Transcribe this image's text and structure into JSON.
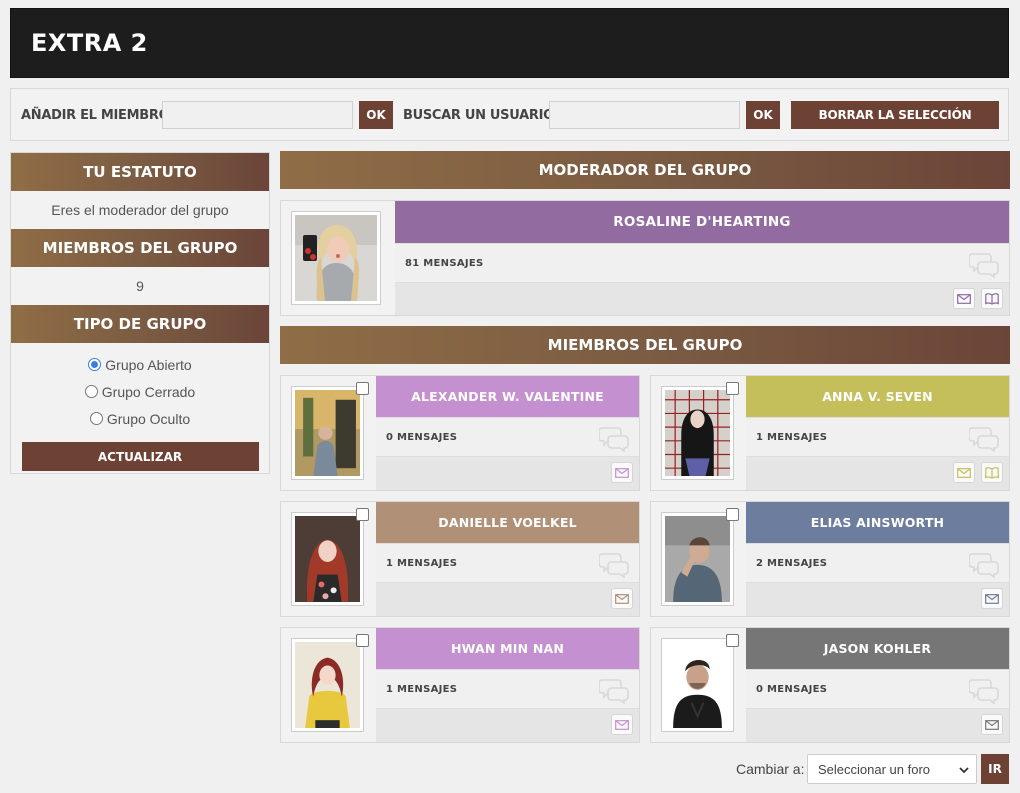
{
  "page": {
    "title": "EXTRA 2"
  },
  "toolbar": {
    "add_member_label": "AÑADIR EL MIEMBRO",
    "add_member_value": "",
    "ok_label": "OK",
    "search_user_label": "BUSCAR UN USUARIO",
    "search_user_value": "",
    "clear_selection_label": "BORRAR LA SELECCIÓN"
  },
  "sidebar": {
    "status_heading": "TU ESTATUTO",
    "status_text": "Eres el moderador del grupo",
    "members_heading": "MIEMBROS DEL GRUPO",
    "members_count": "9",
    "type_heading": "TIPO DE GRUPO",
    "types": [
      {
        "label": "Grupo Abierto",
        "checked": true
      },
      {
        "label": "Grupo Cerrado",
        "checked": false
      },
      {
        "label": "Grupo Oculto",
        "checked": false
      }
    ],
    "update_label": "ACTUALIZAR"
  },
  "moderator_section": {
    "heading": "MODERADOR DEL GRUPO",
    "moderator": {
      "name": "ROSALINE D'HEARTING",
      "messages": "81 MENSAJES",
      "color": "#926ba0",
      "icon_color": "#8e6aa6",
      "icons": [
        "mail-icon",
        "book-icon"
      ]
    }
  },
  "members_section": {
    "heading": "MIEMBROS DEL GRUPO",
    "members": [
      {
        "name": "ALEXANDER W. VALENTINE",
        "messages": "0 MENSAJES",
        "color": "#c490d0",
        "icon_color": "#c490d0",
        "icons": [
          "mail-icon"
        ]
      },
      {
        "name": "ANNA V. SEVEN",
        "messages": "1 MENSAJES",
        "color": "#c4bf5a",
        "icon_color": "#c4bf5a",
        "icons": [
          "mail-icon",
          "book-icon"
        ]
      },
      {
        "name": "DANIELLE VOELKEL",
        "messages": "1 MENSAJES",
        "color": "#b09077",
        "icon_color": "#b09077",
        "icons": [
          "mail-icon"
        ]
      },
      {
        "name": "ELIAS AINSWORTH",
        "messages": "2 MENSAJES",
        "color": "#6d7d9d",
        "icon_color": "#6d7d9d",
        "icons": [
          "mail-icon"
        ]
      },
      {
        "name": "HWAN MIN NAN",
        "messages": "1 MENSAJES",
        "color": "#c490d0",
        "icon_color": "#c490d0",
        "icons": [
          "mail-icon"
        ]
      },
      {
        "name": "JASON KOHLER",
        "messages": "0 MENSAJES",
        "color": "#767676",
        "icon_color": "#767676",
        "icons": [
          "mail-icon"
        ]
      }
    ]
  },
  "footer": {
    "change_label": "Cambiar a:",
    "forum_select_value": "Seleccionar un foro",
    "go_label": "IR"
  }
}
